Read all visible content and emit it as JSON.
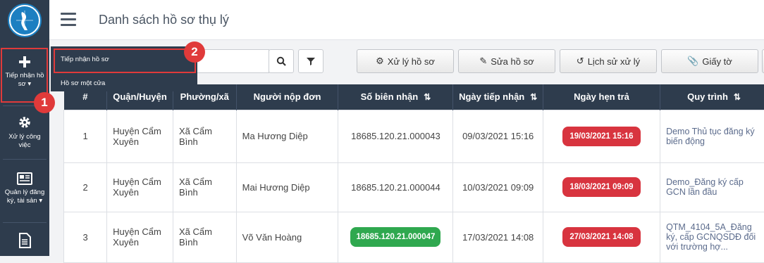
{
  "header": {
    "title": "Danh sách hồ sơ thụ lý"
  },
  "sidebar": {
    "items": [
      {
        "label": "Tiếp nhận hồ sơ ▾",
        "icon": "plus-icon"
      },
      {
        "label": "Xử lý công việc",
        "icon": "gear-icon"
      },
      {
        "label": "Quản lý đăng ký, tài sản ▾",
        "icon": "newspaper-icon"
      },
      {
        "label": "",
        "icon": "document-icon"
      }
    ]
  },
  "dropdown": {
    "items": [
      "Tiếp nhận hồ sơ",
      "Hồ sơ một cửa"
    ]
  },
  "toolbar": {
    "buttons": [
      "Xử lý hồ sơ",
      "Sửa hồ sơ",
      "Lịch sử xử lý",
      "Giấy tờ"
    ]
  },
  "table": {
    "columns": [
      "#",
      "Quận/Huyện",
      "Phường/xã",
      "Người nộp đơn",
      "Số biên nhận",
      "Ngày tiếp nhận",
      "Ngày hẹn trả",
      "Quy trình"
    ],
    "rows": [
      {
        "num": "1",
        "district": "Huyện Cẩm Xuyên",
        "ward": "Xã Cẩm Bình",
        "applicant": "Ma Hương Diệp",
        "receipt": "18685.120.21.000043",
        "received": "09/03/2021 15:16",
        "due": "19/03/2021 15:16",
        "process": "Demo Thủ tục đăng ký biến động"
      },
      {
        "num": "2",
        "district": "Huyện Cẩm Xuyên",
        "ward": "Xã Cẩm Bình",
        "applicant": "Mai Hương Diệp",
        "receipt": "18685.120.21.000044",
        "received": "10/03/2021 09:09",
        "due": "18/03/2021 09:09",
        "process": "Demo_Đăng ký cấp GCN lần đầu"
      },
      {
        "num": "3",
        "district": "Huyện Cẩm Xuyên",
        "ward": "Xã Cẩm Bình",
        "applicant": "Võ Văn Hoàng",
        "receipt": "18685.120.21.000047",
        "received": "17/03/2021 14:08",
        "due": "27/03/2021 14:08",
        "process": "QTM_4104_5A_Đăng ký, cấp GCNQSDĐ đối với trường hợ..."
      }
    ]
  },
  "annotations": [
    "1",
    "2"
  ],
  "colors": {
    "sidebar": "#2e3c4d",
    "highlight": "#e03a3a",
    "badge_red": "#d8343f",
    "badge_green": "#2fa84f"
  }
}
